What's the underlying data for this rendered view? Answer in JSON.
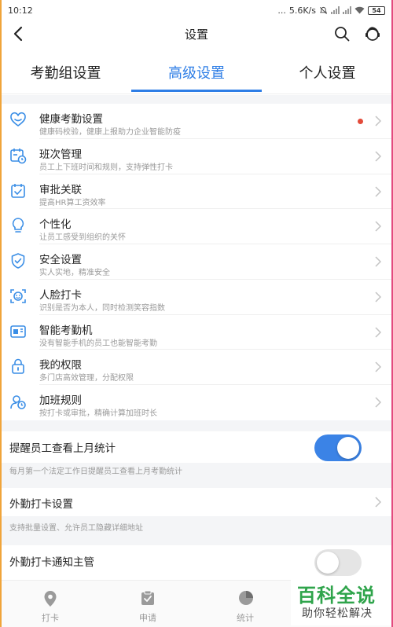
{
  "status_bar": {
    "time": "10:12",
    "dots": "...",
    "speed": "5.6K/s",
    "battery": "54"
  },
  "nav": {
    "title": "设置"
  },
  "tabs": [
    {
      "label": "考勤组设置"
    },
    {
      "label": "高级设置"
    },
    {
      "label": "个人设置"
    }
  ],
  "menu": [
    {
      "title": "健康考勤设置",
      "subtitle": "健康码校验，健康上报助力企业智能防疫",
      "icon": "heart-icon"
    },
    {
      "title": "班次管理",
      "subtitle": "员工上下班时间和规则，支持弹性打卡",
      "icon": "calendar-clock-icon"
    },
    {
      "title": "审批关联",
      "subtitle": "提高HR算工资效率",
      "icon": "approval-check-icon"
    },
    {
      "title": "个性化",
      "subtitle": "让员工感受到组织的关怀",
      "icon": "lightbulb-icon"
    },
    {
      "title": "安全设置",
      "subtitle": "实人实地，精准安全",
      "icon": "shield-check-icon"
    },
    {
      "title": "人脸打卡",
      "subtitle": "识别是否为本人，同时检测笑容指数",
      "icon": "face-scan-icon"
    },
    {
      "title": "智能考勤机",
      "subtitle": "没有智能手机的员工也能智能考勤",
      "icon": "attendance-machine-icon"
    },
    {
      "title": "我的权限",
      "subtitle": "多门店高效管理，分配权限",
      "icon": "lock-icon"
    },
    {
      "title": "加班规则",
      "subtitle": "按打卡或审批，精确计算加班时长",
      "icon": "overtime-user-icon"
    }
  ],
  "settings": {
    "remind_last_month": {
      "title": "提醒员工查看上月统计",
      "note": "每月第一个法定工作日提醒员工查看上月考勤统计",
      "enabled": true
    },
    "field_checkin": {
      "title": "外勤打卡设置",
      "note": "支持批量设置、允许员工隐藏详细地址"
    },
    "field_notify": {
      "title": "外勤打卡通知主管",
      "enabled": false
    }
  },
  "bottom_nav": [
    {
      "label": "打卡",
      "icon": "location-pin-icon"
    },
    {
      "label": "申请",
      "icon": "clipboard-check-icon"
    },
    {
      "label": "统计",
      "icon": "pie-chart-icon"
    }
  ],
  "watermark": {
    "main": "百科全说",
    "sub": "助你轻松解决"
  },
  "colors": {
    "accent": "#2e7ee6",
    "icon_blue": "#3a8ee6",
    "toggle_on": "#3b83e6",
    "toggle_off": "#e5e5e5",
    "dot_red": "#e34b3a",
    "watermark_green": "#2fa44b"
  }
}
